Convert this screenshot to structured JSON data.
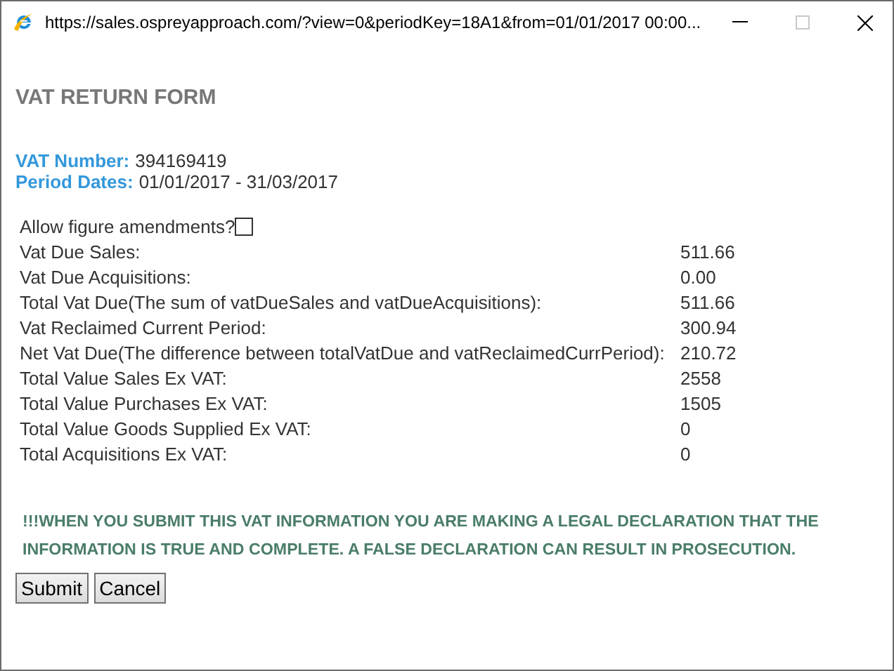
{
  "window": {
    "title": "https://sales.ospreyapproach.com/?view=0&periodKey=18A1&from=01/01/2017 00:00..."
  },
  "heading": "VAT RETURN FORM",
  "info": [
    {
      "label": "VAT Number:",
      "value": "394169419"
    },
    {
      "label": "Period Dates:",
      "value": "01/01/2017 - 31/03/2017"
    }
  ],
  "amendments": {
    "label": "Allow figure amendments?",
    "checked": false
  },
  "figures": [
    {
      "label": "Vat Due Sales:",
      "value": "511.66"
    },
    {
      "label": "Vat Due Acquisitions:",
      "value": "0.00"
    },
    {
      "label": "Total Vat Due(The sum of vatDueSales and vatDueAcquisitions):",
      "value": "511.66"
    },
    {
      "label": "Vat Reclaimed Current Period:",
      "value": "300.94"
    },
    {
      "label": "Net Vat Due(The difference between totalVatDue and vatReclaimedCurrPeriod):",
      "value": "210.72"
    },
    {
      "label": "Total Value Sales Ex VAT:",
      "value": "2558"
    },
    {
      "label": "Total Value Purchases Ex VAT:",
      "value": "1505"
    },
    {
      "label": "Total Value Goods Supplied Ex VAT:",
      "value": "0"
    },
    {
      "label": "Total Acquisitions Ex VAT:",
      "value": "0"
    }
  ],
  "warning": "!!!WHEN YOU SUBMIT THIS VAT INFORMATION YOU ARE MAKING A LEGAL DECLARATION THAT THE INFORMATION IS TRUE AND COMPLETE. A FALSE DECLARATION CAN RESULT IN PROSECUTION.",
  "buttons": [
    "Submit",
    "Cancel"
  ]
}
